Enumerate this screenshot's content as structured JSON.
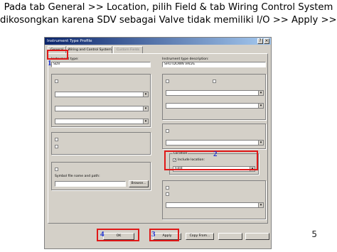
{
  "caption": {
    "line1": "Pada tab General >> Location, pilih Field & tab Wiring Control System",
    "line2": "dikosongkan karena SDV sebagai Valve tidak memiliki I/O >> Apply >>OK"
  },
  "slide_number": "5",
  "dialog": {
    "title": "Instrument Type Profile",
    "tabs": [
      "General",
      "Wiring and Control System",
      "Custom Fields"
    ],
    "instrument_type_label": "Instrument type:",
    "instrument_type_value": "SDV",
    "type_description_label": "Instrument type description:",
    "type_description_value": "SHUTDOWN VALVE",
    "symbols_label": "Symbol file name and path:",
    "browse_label": "Browse..."
  },
  "markers": {
    "m1": "1",
    "m2": "2",
    "m3": "3",
    "m4": "4"
  },
  "location": {
    "group_label": "Location",
    "include_label": "Include location:",
    "selected": "Field"
  },
  "footer": {
    "ok_label": "OK",
    "apply_label": "Apply",
    "copy_label": "Copy From..."
  },
  "colors": {
    "annotation_red": "#e01818",
    "marker_blue": "#1a2fd0",
    "title_bar": "#0a246a",
    "dialog_face": "#d4d0c8"
  }
}
